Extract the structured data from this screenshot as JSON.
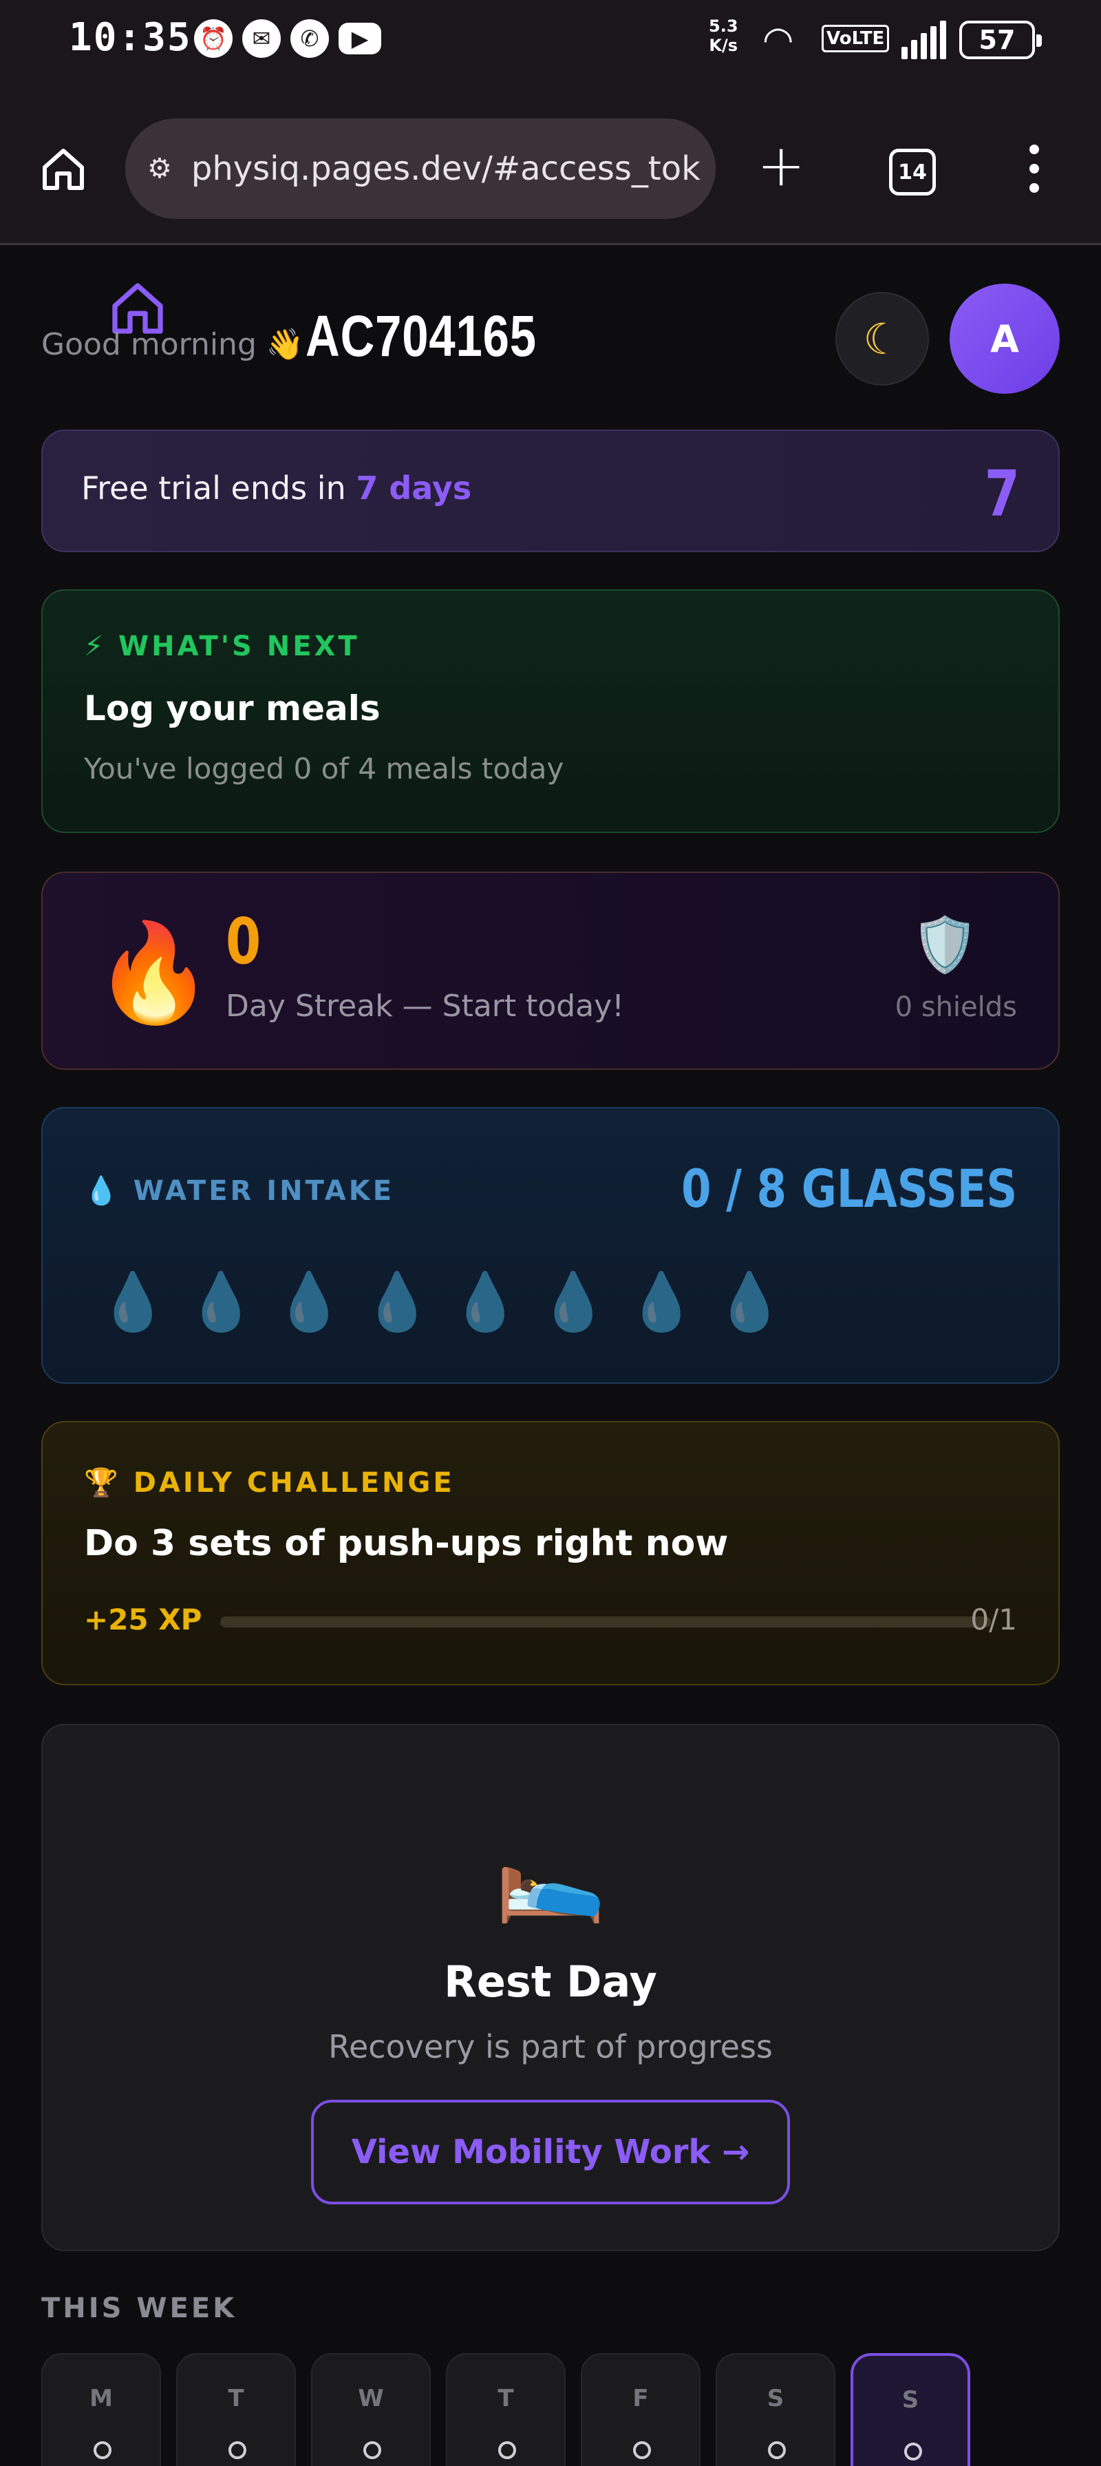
{
  "status_bar": {
    "time": "10:35",
    "net_speed_value": "5.3",
    "net_speed_unit": "K/s",
    "volte": "VoLTE",
    "battery": "57"
  },
  "browser": {
    "url": "physiq.pages.dev/#access_tok",
    "tab_count": "14"
  },
  "header": {
    "greeting": "Good morning 👋",
    "username": "AC704165",
    "avatar_initial": "A"
  },
  "trial": {
    "prefix": "Free trial ends in ",
    "days_text": "7 days",
    "days_number": "7"
  },
  "whats_next": {
    "label": "⚡ WHAT'S NEXT",
    "title": "Log your meals",
    "subtitle": "You've logged 0 of 4 meals today"
  },
  "streak": {
    "count": "0",
    "subtitle": "Day Streak — Start today!",
    "shields": "0 shields"
  },
  "water": {
    "label": "💧 WATER INTAKE",
    "count": "0 / 8 GLASSES",
    "glasses_filled": 0,
    "glasses_total": 8
  },
  "challenge": {
    "label": "🏆 DAILY CHALLENGE",
    "title": "Do 3 sets of push-ups right now",
    "xp": "+25 XP",
    "progress": "0/1",
    "progress_fraction": 0
  },
  "rest_day": {
    "title": "Rest Day",
    "subtitle": "Recovery is part of progress",
    "button": "View Mobility Work →"
  },
  "week": {
    "label": "THIS WEEK",
    "days": [
      "M",
      "T",
      "W",
      "T",
      "F",
      "S",
      "S"
    ],
    "today_index": 6
  },
  "colors": {
    "accent": "#8b5cf6",
    "green": "#22c55e",
    "orange": "#f59e0b",
    "blue": "#4aa3e8",
    "yellow": "#eab308"
  }
}
